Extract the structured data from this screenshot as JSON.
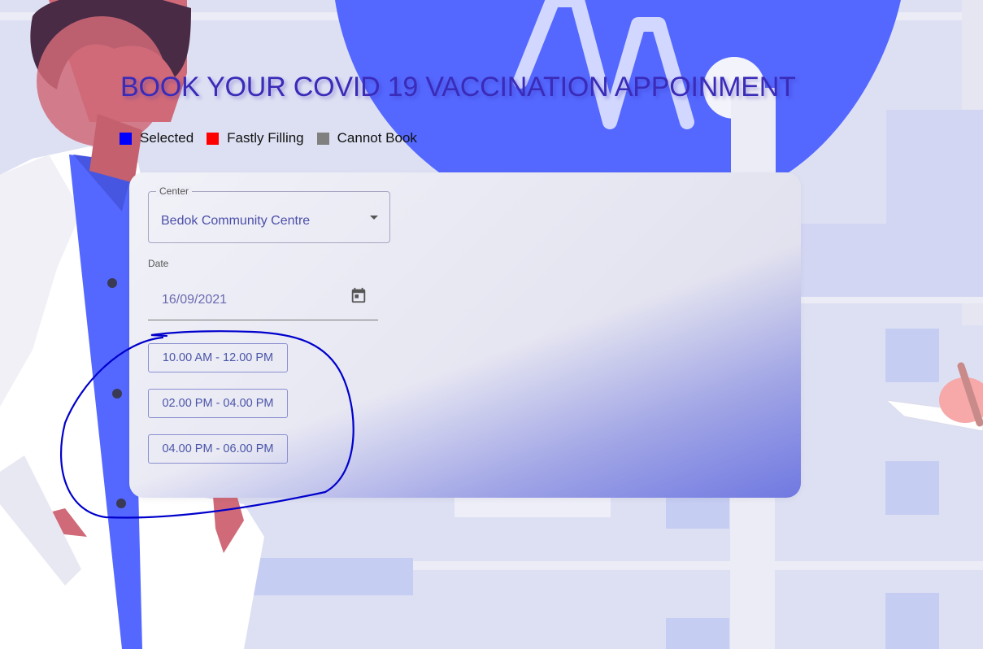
{
  "page": {
    "title": "BOOK YOUR COVID 19 VACCINATION APPOINMENT"
  },
  "legend": [
    {
      "label": "Selected",
      "color": "#0000ff"
    },
    {
      "label": "Fastly Filling",
      "color": "#ff0000"
    },
    {
      "label": "Cannot Book",
      "color": "#808080"
    }
  ],
  "form": {
    "center": {
      "label": "Center",
      "value": "Bedok Community Centre"
    },
    "date": {
      "label": "Date",
      "value": "16/09/2021",
      "icon": "calendar-icon"
    },
    "slots": [
      {
        "label": "10.00 AM - 12.00 PM"
      },
      {
        "label": "02.00 PM - 04.00 PM"
      },
      {
        "label": "04.00 PM - 06.00 PM"
      }
    ]
  },
  "colors": {
    "title": "#3a2bb8",
    "accent": "#5468ff",
    "slot_border": "#8a8fd0",
    "annotation": "#0000cc"
  }
}
